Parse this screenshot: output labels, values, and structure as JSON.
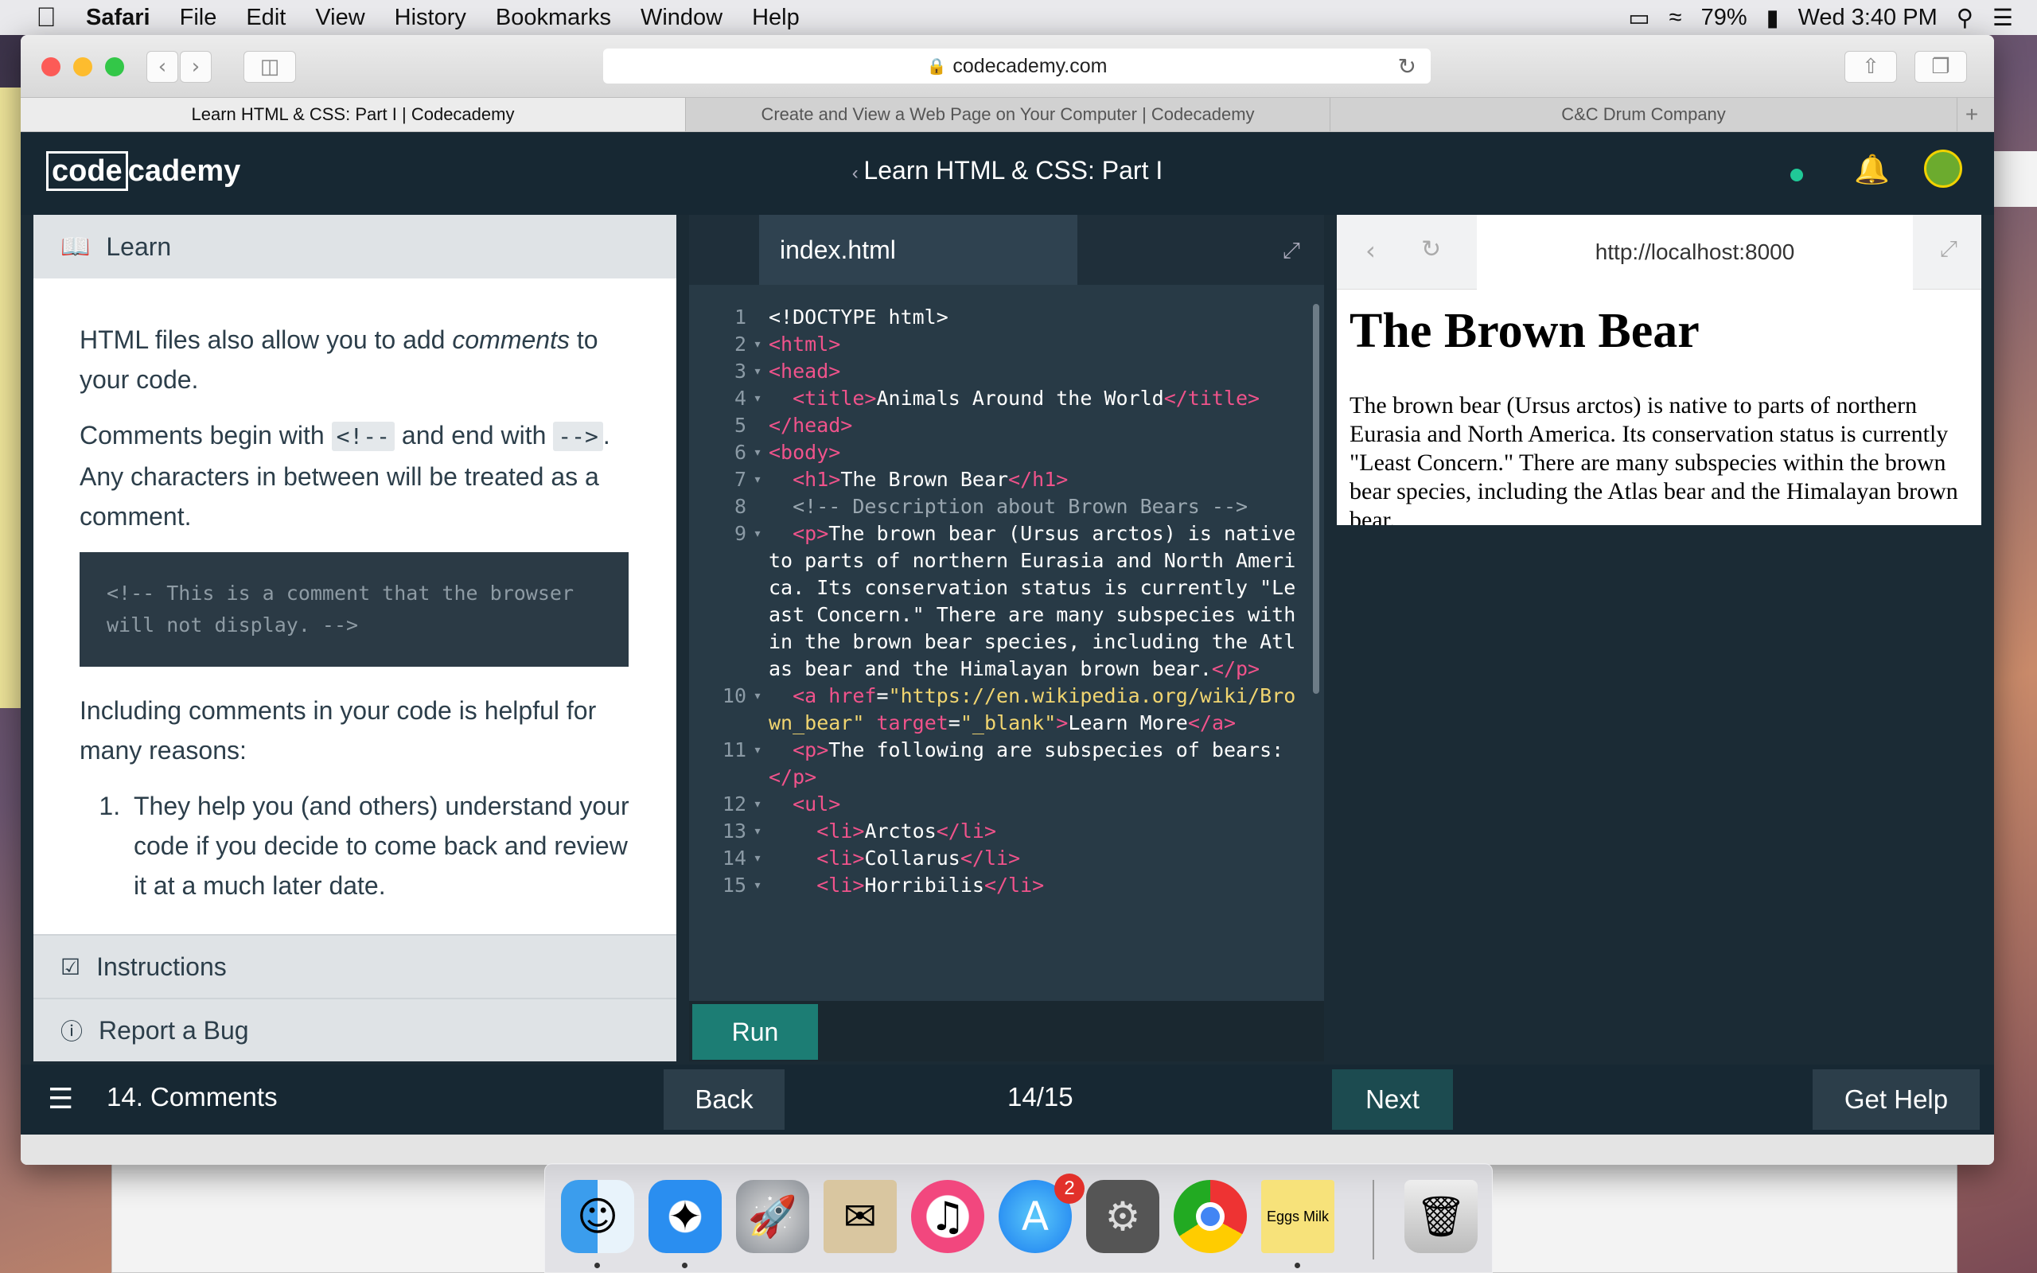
{
  "menubar": {
    "app": "Safari",
    "items": [
      "File",
      "Edit",
      "View",
      "History",
      "Bookmarks",
      "Window",
      "Help"
    ],
    "battery": "79%",
    "clock": "Wed 3:40 PM"
  },
  "safari": {
    "address": "codecademy.com",
    "tabs": [
      "Learn HTML & CSS: Part I | Codecademy",
      "Create and View a Web Page on Your Computer | Codecademy",
      "C&C Drum Company"
    ]
  },
  "header": {
    "logo_a": "code",
    "logo_b": "cademy",
    "course_title": "Learn HTML & CSS: Part I"
  },
  "learn": {
    "title": "Learn",
    "p1_a": "HTML files also allow you to add ",
    "p1_em": "comments",
    "p1_b": " to your code.",
    "p2_a": "Comments begin with ",
    "p2_code1": "<!--",
    "p2_b": " and end with ",
    "p2_code2": "-->",
    "p2_c": ". Any characters in between will be treated as a comment.",
    "code_example": "<!-- This is a comment that the browser will not display. -->",
    "p3": "Including comments in your code is helpful for many reasons:",
    "list_item_1": "They help you (and others) understand your code if you decide to come back and review it at a much later date.",
    "instructions": "Instructions",
    "report_bug": "Report a Bug"
  },
  "editor": {
    "filename": "index.html",
    "run_label": "Run",
    "lines": [
      {
        "n": "1",
        "fold": false,
        "html": "&lt;!DOCTYPE html&gt;"
      },
      {
        "n": "2",
        "fold": true,
        "html": "<span class='t'>&lt;html&gt;</span>"
      },
      {
        "n": "3",
        "fold": true,
        "html": "<span class='t'>&lt;head&gt;</span>"
      },
      {
        "n": "4",
        "fold": true,
        "html": "  <span class='t'>&lt;title&gt;</span>Animals Around the World<span class='t'>&lt;/title&gt;</span>"
      },
      {
        "n": "5",
        "fold": false,
        "html": "<span class='t'>&lt;/head&gt;</span>"
      },
      {
        "n": "6",
        "fold": true,
        "html": "<span class='t'>&lt;body&gt;</span>"
      },
      {
        "n": "7",
        "fold": true,
        "html": "  <span class='t'>&lt;h1&gt;</span>The Brown Bear<span class='t'>&lt;/h1&gt;</span>"
      },
      {
        "n": "8",
        "fold": false,
        "html": "  <span class='cm'>&lt;!-- Description about Brown Bears --&gt;</span>"
      },
      {
        "n": "9",
        "fold": true,
        "html": "  <span class='t'>&lt;p&gt;</span>The brown bear (Ursus arctos) is native to parts of northern Eurasia and North America. Its conservation status is currently \"Least Concern.\" There are many subspecies within the brown bear species, including the Atlas bear and the Himalayan brown bear.<span class='t'>&lt;/p&gt;</span>"
      },
      {
        "n": "10",
        "fold": true,
        "html": "  <span class='t'>&lt;a</span> <span class='at'>href</span>=<span class='s'>\"https://en.wikipedia.org/wiki/Brown_bear\"</span> <span class='at'>target</span>=<span class='s'>\"_blank\"</span><span class='t'>&gt;</span>Learn More<span class='t'>&lt;/a&gt;</span>"
      },
      {
        "n": "11",
        "fold": true,
        "html": "  <span class='t'>&lt;p&gt;</span>The following are subspecies of bears:<span class='t'>&lt;/p&gt;</span>"
      },
      {
        "n": "12",
        "fold": true,
        "html": "  <span class='t'>&lt;ul&gt;</span>"
      },
      {
        "n": "13",
        "fold": true,
        "html": "    <span class='t'>&lt;li&gt;</span>Arctos<span class='t'>&lt;/li&gt;</span>"
      },
      {
        "n": "14",
        "fold": true,
        "html": "    <span class='t'>&lt;li&gt;</span>Collarus<span class='t'>&lt;/li&gt;</span>"
      },
      {
        "n": "15",
        "fold": true,
        "html": "    <span class='t'>&lt;li&gt;</span>Horribilis<span class='t'>&lt;/li&gt;</span>"
      }
    ]
  },
  "preview": {
    "url": "http://localhost:8000",
    "h1": "The Brown Bear",
    "p": "The brown bear (Ursus arctos) is native to parts of northern Eurasia and North America. Its conservation status is currently \"Least Concern.\" There are many subspecies within the brown bear species, including the Atlas bear and the Himalayan brown bear."
  },
  "footer": {
    "lesson": "14. Comments",
    "back": "Back",
    "progress": "14/15",
    "next": "Next",
    "help": "Get Help"
  },
  "dock": {
    "appstore_badge": "2",
    "stickies_note": "Eggs Milk"
  },
  "colors": {
    "cc_dark": "#172833",
    "run_green": "#1c7d74",
    "tag_pink": "#f0538b",
    "string_yellow": "#f1d570"
  }
}
